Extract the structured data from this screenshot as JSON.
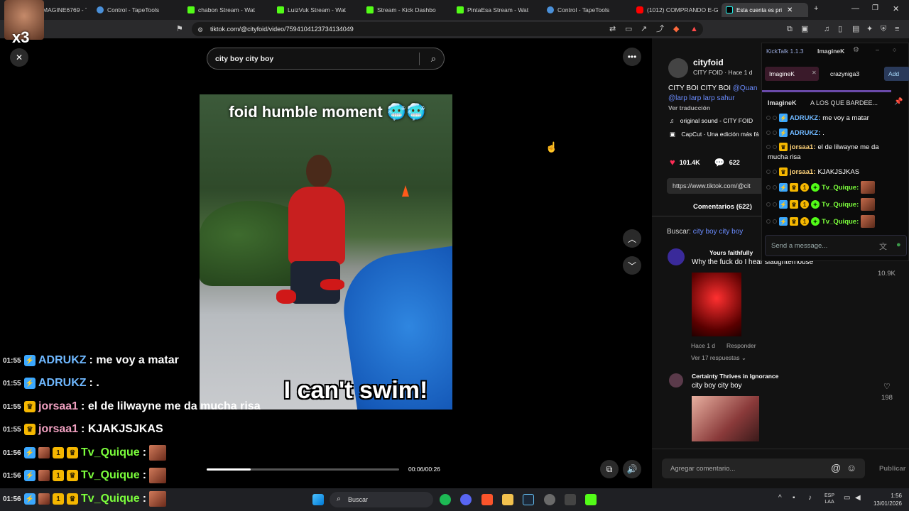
{
  "browser": {
    "tabs": [
      {
        "label": "MAGINE6769 - T",
        "favicon": "kick"
      },
      {
        "label": "Control - TapeTools",
        "favicon": "tape"
      },
      {
        "label": "chabon Stream - Wat",
        "favicon": "kick"
      },
      {
        "label": "LuizVuk Stream - Wat",
        "favicon": "kick"
      },
      {
        "label": "Stream - Kick Dashbo",
        "favicon": "kick"
      },
      {
        "label": "PintaEsa Stream - Wat",
        "favicon": "kick"
      },
      {
        "label": "Control - TapeTools",
        "favicon": "tape"
      },
      {
        "label": "(1012) COMPRANDO E-GI",
        "favicon": "youtube"
      },
      {
        "label": "Esta cuenta es pri",
        "favicon": "tiktok"
      }
    ],
    "url": "tiktok.com/@cityfoid/video/7594104123734134049"
  },
  "overlay": {
    "multiplier": "x3"
  },
  "video": {
    "search_query": "city boy city boy",
    "caption_top": "foid humble moment 🥶🥶",
    "caption_bottom": "I can't swim!",
    "time": "00:06/00:26",
    "progress": 0.23
  },
  "post": {
    "username": "cityfoid",
    "subline": "CITY FOID · Hace 1 d",
    "description": "CITY BOI CITY BOI",
    "mention": "@Quan",
    "description2": "@larp larp larp sahur",
    "translate": "Ver traducción",
    "sound": "original sound - CITY FOID",
    "capcut": "CapCut · Una edición más fá",
    "likes": "101.4K",
    "comments_count": "622",
    "link": "https://www.tiktok.com/@cit",
    "comments_tab": "Comentarios (622)",
    "search_label": "Buscar:",
    "search_value": "city boy city boy",
    "comments": [
      {
        "author": "Yours faithfully",
        "text": "Why the fuck do I hear slaughterhouse",
        "likes": "10.9K",
        "meta": "Hace 1 d",
        "reply": "Responder",
        "replies": "Ver 17 respuestas"
      },
      {
        "author": "Certainty Thrives in Ignorance",
        "text": "city boy city boy",
        "likes": "198"
      }
    ],
    "add_comment": "Agregar comentario...",
    "publish": "Publicar"
  },
  "kicktalk": {
    "app": "KickTalk 1.1.3",
    "user": "ImagineK",
    "tabs": [
      "ImagineK",
      "crazyniga3"
    ],
    "add": "Add",
    "pinned_user": "ImagineK",
    "pinned_text": "A LOS QUE BARDEE...",
    "messages": [
      {
        "user": "ADRUKZ:",
        "text": "me voy a matar",
        "color": "#6fb8ff"
      },
      {
        "user": "ADRUKZ:",
        "text": ".",
        "color": "#6fb8ff"
      },
      {
        "user": "jorsaa1:",
        "text": "el de lilwayne me da",
        "color": "#ffd37a"
      },
      {
        "user": "jorsaa1:",
        "text": "KJAKJSJKAS",
        "color": "#ffd37a"
      },
      {
        "user": "Tv_Quique:",
        "text": "",
        "color": "#7cff3c"
      },
      {
        "user": "Tv_Quique:",
        "text": "",
        "color": "#7cff3c"
      },
      {
        "user": "Tv_Quique:",
        "text": "",
        "color": "#7cff3c"
      }
    ],
    "message_continuation": "mucha risa",
    "input_placeholder": "Send a message..."
  },
  "chat_overlay": [
    {
      "time": "01:55",
      "user": "ADRUKZ",
      "text": ": me voy a matar",
      "color": "#6fb8ff"
    },
    {
      "time": "01:55",
      "user": "ADRUKZ",
      "text": ": .",
      "color": "#6fb8ff"
    },
    {
      "time": "01:55",
      "user": "jorsaa1",
      "text": ": el de lilwayne me da mucha risa",
      "color": "#f0a0c0"
    },
    {
      "time": "01:55",
      "user": "jorsaa1",
      "text": ": KJAKJSJKAS",
      "color": "#f0a0c0"
    },
    {
      "time": "01:56",
      "user": "Tv_Quique",
      "text": ":",
      "color": "#7cff3c"
    },
    {
      "time": "01:56",
      "user": "Tv_Quique",
      "text": ":",
      "color": "#7cff3c"
    },
    {
      "time": "01:56",
      "user": "Tv_Quique",
      "text": ":",
      "color": "#7cff3c"
    }
  ],
  "taskbar": {
    "search_label": "Buscar",
    "lang1": "ESP",
    "lang2": "LAA",
    "clock_time": "1:56",
    "clock_date": "13/01/2026"
  }
}
